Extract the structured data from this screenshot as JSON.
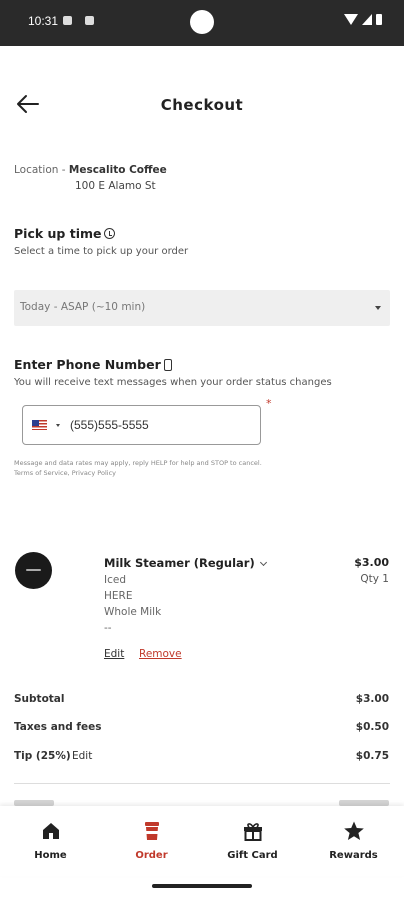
{
  "status_bar": {
    "time": "10:31"
  },
  "header": {
    "title": "Checkout"
  },
  "location": {
    "prefix": "Location - ",
    "name": "Mescalito Coffee",
    "address": "100 E Alamo St"
  },
  "pickup": {
    "title": "Pick up time",
    "subtitle": "Select a time to pick up your order",
    "selected": "Today - ASAP (~10 min)"
  },
  "phone": {
    "title": "Enter Phone Number",
    "subtitle": "You will receive text messages when your order status changes",
    "value": "(555)555-5555",
    "required_mark": "*",
    "disclaimer_line1": "Message and data rates may apply, reply HELP for help and STOP to cancel.",
    "disclaimer_line2": "Terms of Service, Privacy Policy"
  },
  "cart": {
    "items": [
      {
        "name": "Milk Steamer (Regular)",
        "price": "$3.00",
        "qty": "Qty 1",
        "modifiers": [
          "Iced",
          "HERE",
          "Whole Milk",
          "--"
        ],
        "edit_label": "Edit",
        "remove_label": "Remove"
      }
    ]
  },
  "summary": {
    "subtotal_label": "Subtotal",
    "subtotal": "$3.00",
    "taxes_label": "Taxes and fees",
    "taxes": "$0.50",
    "tip_label": "Tip (25%)",
    "tip_edit": "Edit",
    "tip": "$0.75"
  },
  "bottom_nav": {
    "items": [
      {
        "label": "Home",
        "icon": "home-icon"
      },
      {
        "label": "Order",
        "icon": "cup-icon"
      },
      {
        "label": "Gift Card",
        "icon": "gift-icon"
      },
      {
        "label": "Rewards",
        "icon": "star-icon"
      }
    ],
    "active_color": "#c0392b"
  },
  "colors": {
    "accent": "#c0392b",
    "dropdown_bg": "#efefef",
    "status_bar": "#2a2a2a"
  }
}
